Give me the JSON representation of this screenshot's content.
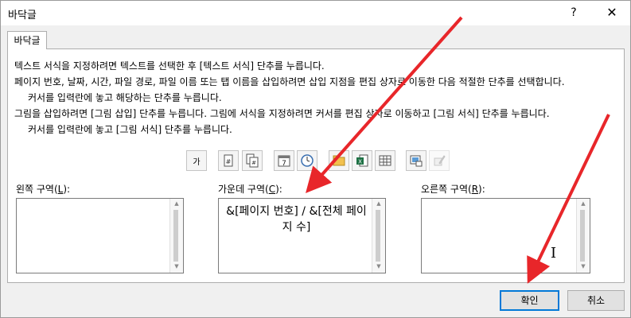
{
  "dialog": {
    "title": "바닥글",
    "help_glyph": "?",
    "close_glyph": "✕"
  },
  "tab": {
    "label": "바닥글"
  },
  "instructions": [
    "텍스트 서식을 지정하려면 텍스트를 선택한 후 [텍스트 서식] 단추를 누릅니다.",
    "페이지 번호, 날짜, 시간, 파일 경로, 파일 이름 또는 탭 이름을 삽입하려면 삽입 지점을 편집 상자로 이동한 다음 적절한 단추를 선택합니다.",
    "커서를 입력란에 놓고 해당하는 단추를 누릅니다.",
    "그림을 삽입하려면 [그림 삽입] 단추를 누릅니다. 그림에 서식을 지정하려면 커서를 편집 상자로 이동하고 [그림 서식] 단추를 누릅니다.",
    "커서를 입력란에 놓고 [그림 서식] 단추를 누릅니다."
  ],
  "toolbar": [
    {
      "name": "format-text-icon",
      "glyph": "가"
    },
    {
      "name": "insert-page-number-icon",
      "glyph": "#"
    },
    {
      "name": "insert-number-of-pages-icon",
      "glyph": "##"
    },
    {
      "name": "insert-date-icon",
      "glyph": "7"
    },
    {
      "name": "insert-time-icon",
      "glyph": "◷"
    },
    {
      "name": "insert-file-path-icon",
      "glyph": "▤"
    },
    {
      "name": "insert-file-name-icon",
      "glyph": "X"
    },
    {
      "name": "insert-sheet-name-icon",
      "glyph": "▦"
    },
    {
      "name": "insert-picture-icon",
      "glyph": "▣"
    },
    {
      "name": "format-picture-icon",
      "glyph": "✎"
    }
  ],
  "sections": {
    "left": {
      "label": "왼쪽 구역(",
      "key": "L",
      "suffix": "):",
      "content": ""
    },
    "center": {
      "label": "가운데 구역(",
      "key": "C",
      "suffix": "):",
      "content": "&[페이지 번호] / &[전체 페이지 수]"
    },
    "right": {
      "label": "오른쪽 구역(",
      "key": "R",
      "suffix": "):",
      "content": ""
    }
  },
  "buttons": {
    "ok": "확인",
    "cancel": "취소"
  },
  "colors": {
    "annotation_arrow": "#e8262a",
    "accent": "#0078d7"
  }
}
